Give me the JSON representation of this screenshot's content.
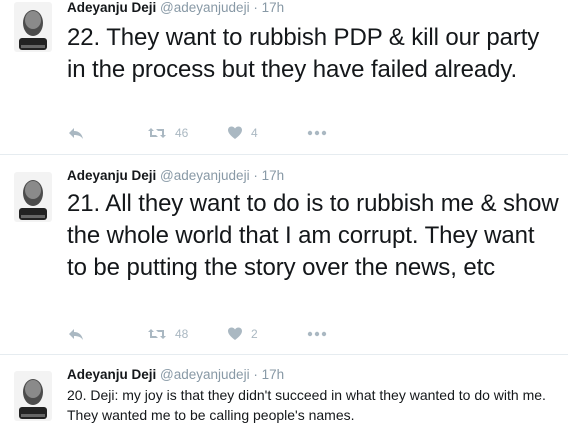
{
  "tweets": [
    {
      "author": "Adeyanju Deji",
      "handle": "@adeyanjudeji",
      "separator": "·",
      "time": "17h",
      "text": "22. They want to rubbish PDP & kill our party in the process but they have failed already.",
      "retweets": "46",
      "likes": "4",
      "size": "big"
    },
    {
      "author": "Adeyanju Deji",
      "handle": "@adeyanjudeji",
      "separator": "·",
      "time": "17h",
      "text": "21. All they want to do is to rubbish me & show the whole world that I am corrupt. They want to be putting the story over the news, etc",
      "retweets": "48",
      "likes": "2",
      "size": "big"
    },
    {
      "author": "Adeyanju Deji",
      "handle": "@adeyanjudeji",
      "separator": "·",
      "time": "17h",
      "text": "20. Deji: my joy is that they didn't succeed in what they wanted to do with me. They wanted me to be calling people's names.",
      "size": "small"
    }
  ],
  "icons": {
    "reply": "reply-icon",
    "retweet": "retweet-icon",
    "like": "heart-icon",
    "more": "more-icon"
  },
  "colors": {
    "text": "#14171a",
    "muted": "#8899a6",
    "icon": "#aab8c2",
    "divider": "#e6ecf0"
  }
}
